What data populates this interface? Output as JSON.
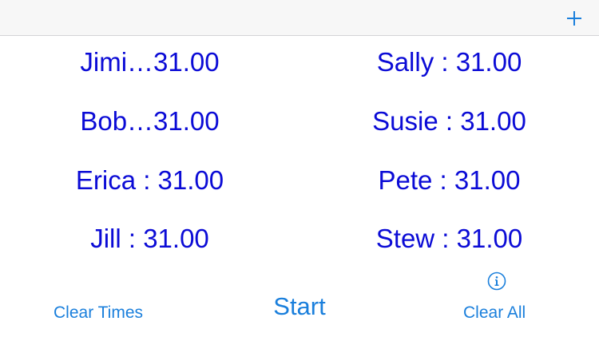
{
  "navbar": {
    "add_icon": "plus-icon",
    "accent_color": "#1a7fdc"
  },
  "timers": [
    {
      "label": "Jimi…31.00"
    },
    {
      "label": "Sally : 31.00"
    },
    {
      "label": "Bob…31.00"
    },
    {
      "label": "Susie : 31.00"
    },
    {
      "label": "Erica : 31.00"
    },
    {
      "label": "Pete : 31.00"
    },
    {
      "label": "Jill : 31.00"
    },
    {
      "label": "Stew : 31.00"
    }
  ],
  "timer_text_color": "#0b0bd6",
  "toolbar": {
    "clear_times_label": "Clear Times",
    "start_label": "Start",
    "clear_all_label": "Clear All",
    "info_icon": "info-icon"
  }
}
